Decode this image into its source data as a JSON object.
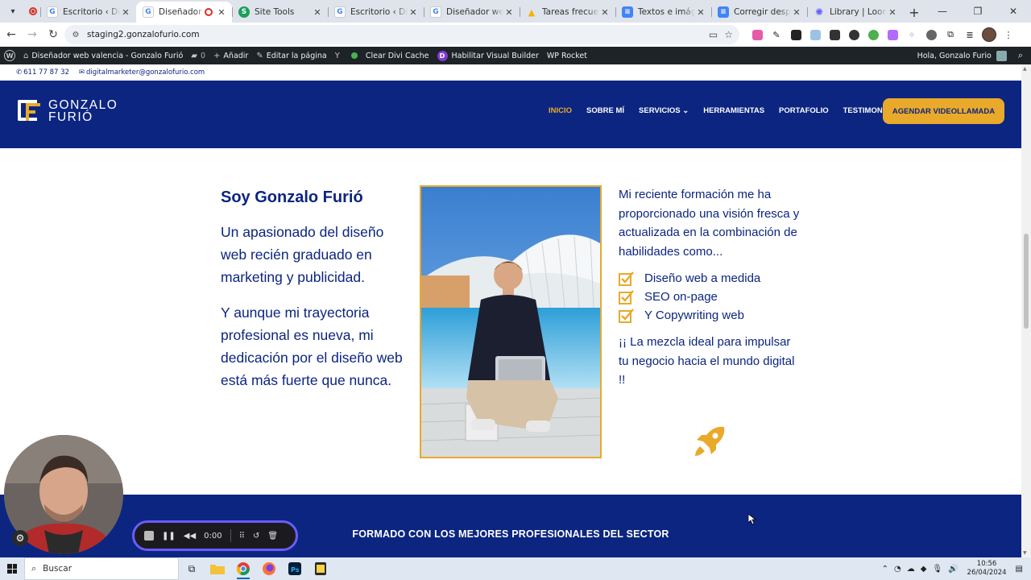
{
  "browser": {
    "tabs": [
      {
        "label": "Escritorio ‹ Diseñador web",
        "favicon": "G",
        "color": "#5f6368",
        "active": false
      },
      {
        "label": "Diseñador web valencia",
        "favicon": "G",
        "color": "#5f6368",
        "active": true
      },
      {
        "label": "Site Tools",
        "favicon": "S",
        "color": "#1a9e5c",
        "active": false
      },
      {
        "label": "Escritorio ‹ Diseñador web",
        "favicon": "G",
        "color": "#5f6368",
        "active": false
      },
      {
        "label": "Diseñador web valencia",
        "favicon": "G",
        "color": "#5f6368",
        "active": false
      },
      {
        "label": "Tareas frecuentes - Google",
        "favicon": "▲",
        "color": "#f4b400",
        "active": false
      },
      {
        "label": "Textos e imágenes de la web",
        "favicon": "≡",
        "color": "#4285f4",
        "active": false
      },
      {
        "label": "Corregir desplazamiento",
        "favicon": "≡",
        "color": "#4285f4",
        "active": false
      },
      {
        "label": "Library | Loom",
        "favicon": "✺",
        "color": "#625df5",
        "active": false
      }
    ],
    "url": "staging2.gonzalofurio.com"
  },
  "adminbar": {
    "site_name": "Diseñador web valencia - Gonzalo Furió",
    "comments": "0",
    "add_new": "Añadir",
    "edit_page": "Editar la página",
    "clear_cache": "Clear Divi Cache",
    "visual_builder": "Habilitar Visual Builder",
    "wp_rocket": "WP Rocket",
    "greeting": "Hola, Gonzalo Furio"
  },
  "topinfo": {
    "phone": "611 77 87 32",
    "email": "digitalmarketer@gonzalofurio.com"
  },
  "header": {
    "logo_line1": "GONZALO",
    "logo_line2": "FURIÓ",
    "nav": [
      "INICIO",
      "SOBRE MÍ",
      "SERVICIOS",
      "HERRAMIENTAS",
      "PORTAFOLIO",
      "TESTIMONIOS"
    ],
    "cta": "AGENDAR VIDEOLLAMADA"
  },
  "content": {
    "heading": "Soy Gonzalo Furió",
    "para1": "Un apasionado del diseño web recién graduado en marketing y publicidad.",
    "para2": "Y aunque mi trayectoria profesional es nueva, mi dedicación por el diseño web está más fuerte que nunca.",
    "intro": "Mi reciente formación me ha proporcionado una visión fresca y actualizada en la combinación de habilidades como...",
    "skills": [
      "Diseño web a medida",
      "SEO on-page",
      "Y Copywriting web"
    ],
    "closing": "¡¡ La mezcla ideal para impulsar tu negocio hacia el mundo digital !!",
    "band_title": "FORMADO CON LOS MEJORES PROFESIONALES DEL SECTOR"
  },
  "loom": {
    "time": "0:00"
  },
  "taskbar": {
    "search": "Buscar",
    "time": "10:56",
    "date": "26/04/2024"
  },
  "colors": {
    "brand_blue": "#0c2580",
    "accent_gold": "#e9a92a",
    "admin_bar": "#1d2327"
  }
}
